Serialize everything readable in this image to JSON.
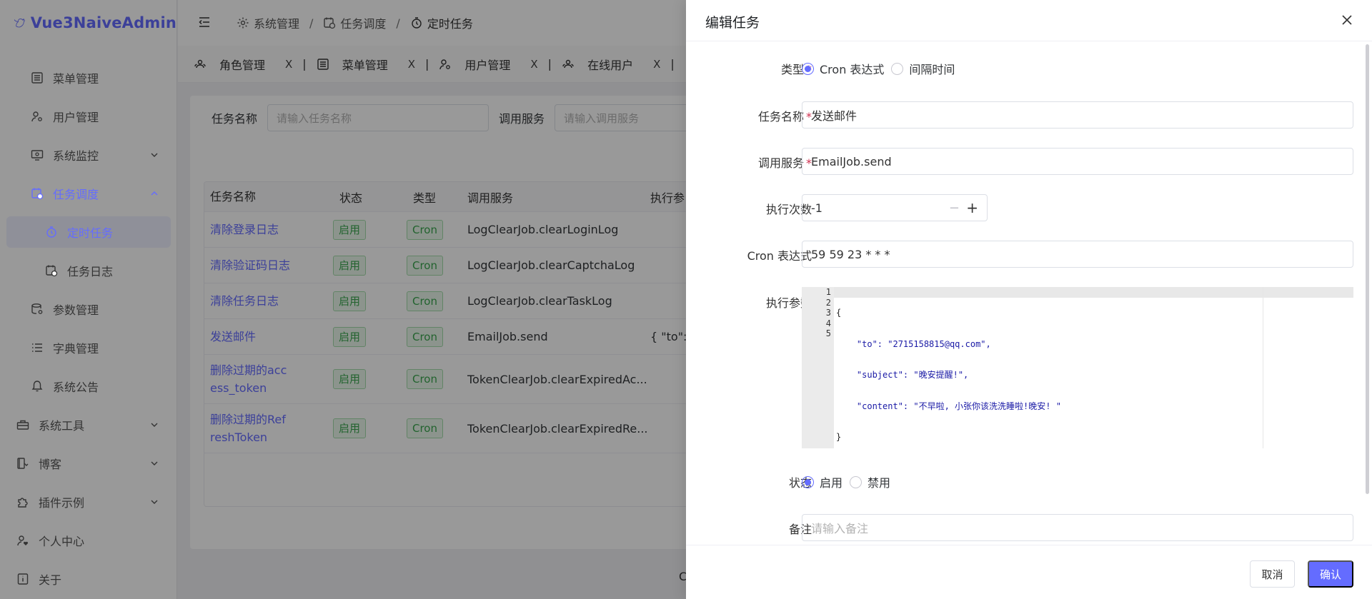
{
  "app": {
    "name": "Vue3NaiveAdmin"
  },
  "sidebar": {
    "items": [
      {
        "label": "菜单管理",
        "icon": "menu-list-icon"
      },
      {
        "label": "用户管理",
        "icon": "user-settings-icon"
      },
      {
        "label": "系统监控",
        "icon": "monitor-icon"
      },
      {
        "label": "任务调度",
        "icon": "calendar-clock-icon"
      },
      {
        "label": "定时任务",
        "icon": "clock-timer-icon"
      },
      {
        "label": "任务日志",
        "icon": "log-icon"
      },
      {
        "label": "参数管理",
        "icon": "database-settings-icon"
      },
      {
        "label": "字典管理",
        "icon": "list-icon"
      },
      {
        "label": "系统公告",
        "icon": "bell-icon"
      },
      {
        "label": "系统工具",
        "icon": "toolbox-icon"
      },
      {
        "label": "博客",
        "icon": "book-icon"
      },
      {
        "label": "插件示例",
        "icon": "puzzle-icon"
      },
      {
        "label": "个人中心",
        "icon": "user-heart-icon"
      },
      {
        "label": "关于",
        "icon": "info-icon"
      }
    ]
  },
  "breadcrumb": [
    "系统管理",
    "任务调度",
    "定时任务"
  ],
  "tabs": [
    {
      "label": "角色管理"
    },
    {
      "label": "菜单管理"
    },
    {
      "label": "用户管理"
    },
    {
      "label": "在线用户"
    }
  ],
  "filter": {
    "name_label": "任务名称",
    "name_placeholder": "请输入任务名称",
    "service_label": "调用服务",
    "service_placeholder": "请输入调用服务"
  },
  "table": {
    "headers": [
      "任务名称",
      "状态",
      "类型",
      "调用服务",
      "执行参"
    ],
    "rows": [
      {
        "name": "清除登录日志",
        "status": "启用",
        "type": "Cron",
        "service": "LogClearJob.clearLoginLog",
        "param": ""
      },
      {
        "name": "清除验证码日志",
        "status": "启用",
        "type": "Cron",
        "service": "LogClearJob.clearCaptchaLog",
        "param": ""
      },
      {
        "name": "清除任务日志",
        "status": "启用",
        "type": "Cron",
        "service": "LogClearJob.clearTaskLog",
        "param": ""
      },
      {
        "name": "发送邮件",
        "status": "启用",
        "type": "Cron",
        "service": "EmailJob.send",
        "param": "{ \"to\":"
      },
      {
        "name": "删除过期的access_token",
        "status": "启用",
        "type": "Cron",
        "service": "TokenClearJob.clearExpiredAc...",
        "param": ""
      },
      {
        "name": "删除过期的RefreshToken",
        "status": "启用",
        "type": "Cron",
        "service": "TokenClearJob.clearExpiredRe...",
        "param": ""
      }
    ]
  },
  "pager_fragment": "C",
  "drawer": {
    "title": "编辑任务",
    "type_label": "类型",
    "type_options": [
      "Cron 表达式",
      "间隔时间"
    ],
    "type_selected": "Cron 表达式",
    "name_label": "任务名称",
    "name_value": "发送邮件",
    "service_label": "调用服务",
    "service_value": "EmailJob.send",
    "count_label": "执行次数",
    "count_value": "-1",
    "cron_label": "Cron 表达式",
    "cron_value": "59 59 23 * * *",
    "params_label": "执行参数",
    "params_lines": [
      "{",
      "    \"to\": \"2715158815@qq.com\",",
      "    \"subject\": \"晚安提醒!\",",
      "    \"content\": \"不早啦, 小张你该洗洗睡啦!晚安! \"",
      "}"
    ],
    "line_numbers": [
      "1",
      "2",
      "3",
      "4",
      "5"
    ],
    "status_label": "状态",
    "status_options": [
      "启用",
      "禁用"
    ],
    "status_selected": "启用",
    "remark_label": "备注",
    "remark_placeholder": "请输入备注",
    "cancel_label": "取消",
    "confirm_label": "确认"
  },
  "colors": {
    "primary": "#646cff",
    "success": "#3aa54e",
    "required": "#d03050"
  }
}
